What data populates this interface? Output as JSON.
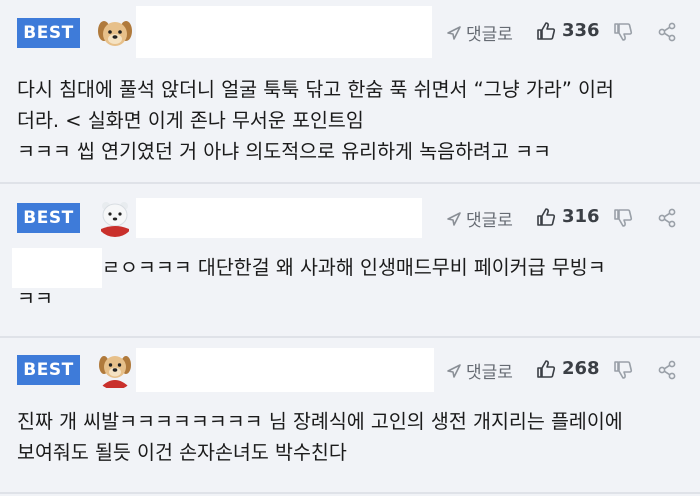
{
  "badge_label": "BEST",
  "reply_label": "댓글로",
  "comments": [
    {
      "likes": "336",
      "lines": [
        "다시 침대에 풀석 앉더니 얼굴 툭툭 닦고 한숨 푹 쉬면서 “그냥 가라” 이러",
        "더라. < 실화면 이게 존나 무서운 포인트임",
        "ㅋㅋㅋ 씹 연기였던 거 아냐 의도적으로 유리하게 녹음하려고 ㅋㅋ"
      ]
    },
    {
      "likes": "316",
      "lines": [
        "ㄹㅇㅋㅋㅋ 대단한걸 왜 사과해 인생매드무비 페이커급 무빙ㅋ",
        "ㅋㅋ"
      ]
    },
    {
      "likes": "268",
      "lines": [
        "진짜 개 씨발ㅋㅋㅋㅋㅋㅋㅋㅋ 님 장례식에 고인의 생전 개지리는 플레이에",
        "보여줘도 될듯 이건 손자손녀도 박수친다"
      ]
    }
  ],
  "colors": {
    "badge": "#3e7bd9",
    "background": "#f1f3f7",
    "text": "#1b1b1b",
    "meta": "#666b73"
  },
  "icons": [
    "reply-arrow-icon",
    "thumbs-up-icon",
    "thumbs-down-icon",
    "share-icon"
  ]
}
